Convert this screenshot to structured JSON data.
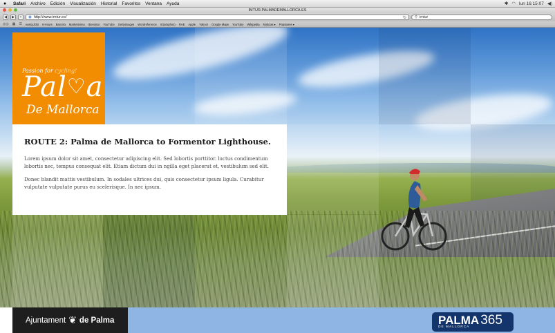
{
  "menubar": {
    "apple": "",
    "items": [
      "Safari",
      "Archivo",
      "Edición",
      "Visualización",
      "Historial",
      "Favoritos",
      "Ventana",
      "Ayuda"
    ],
    "clock": "lun 16:15:07",
    "tray": [
      "bluetooth-icon",
      "wifi-icon",
      "volume-icon"
    ]
  },
  "window": {
    "title": "IMTUR.PALMADEMALLORCA.ES"
  },
  "toolbar": {
    "back": "◀",
    "forward": "▶",
    "add": "+",
    "url": "http://www.imtur.es/",
    "search_value": "imtur"
  },
  "bookmarks": {
    "items": [
      "eassyJOB",
      "9 Hours",
      "Barcelo",
      "Marketinima",
      "Iberostar",
      "YouTube",
      "Gettyimages",
      "Wordreference",
      "iStockphoto",
      "RAE",
      "Apple",
      "Yahoo!",
      "Google Maps",
      "YouTube",
      "Wikipedia",
      "Noticias ▾",
      "Populares ▾"
    ]
  },
  "logo": {
    "tagline_a": "Passion for",
    "tagline_b": "cycling!",
    "name_a": "Pal",
    "name_b": "a",
    "subname": "De Mallorca"
  },
  "article": {
    "title": "ROUTE 2: Palma de Mallorca to Formentor Lighthouse.",
    "paragraph1": "Lorem ipsum dolor sit amet, consectetur adipiscing elit. Sed lobortis porttitor. luctus condimentum lobortis nec, tempus consequat elit. Etiam dictum dui in ngilla eget placerat et, vestibulum sed elit.",
    "paragraph2": "Donec blandit mattis vestibulum. In sodales ultrices dui, quis consectetur ipsum ligula. Curabitur vulputate vulputate purus eu scelerisque. In nec ipsum."
  },
  "footer": {
    "left_a": "Ajuntament",
    "left_b": "de Palma",
    "brand_a": "PALMA",
    "brand_b": "365",
    "brand_sub": "DE MALLORCA"
  },
  "colors": {
    "orange": "#f28c00",
    "navy": "#13356b",
    "light_blue": "#8fb5e4",
    "dark": "#1e1e1e"
  }
}
